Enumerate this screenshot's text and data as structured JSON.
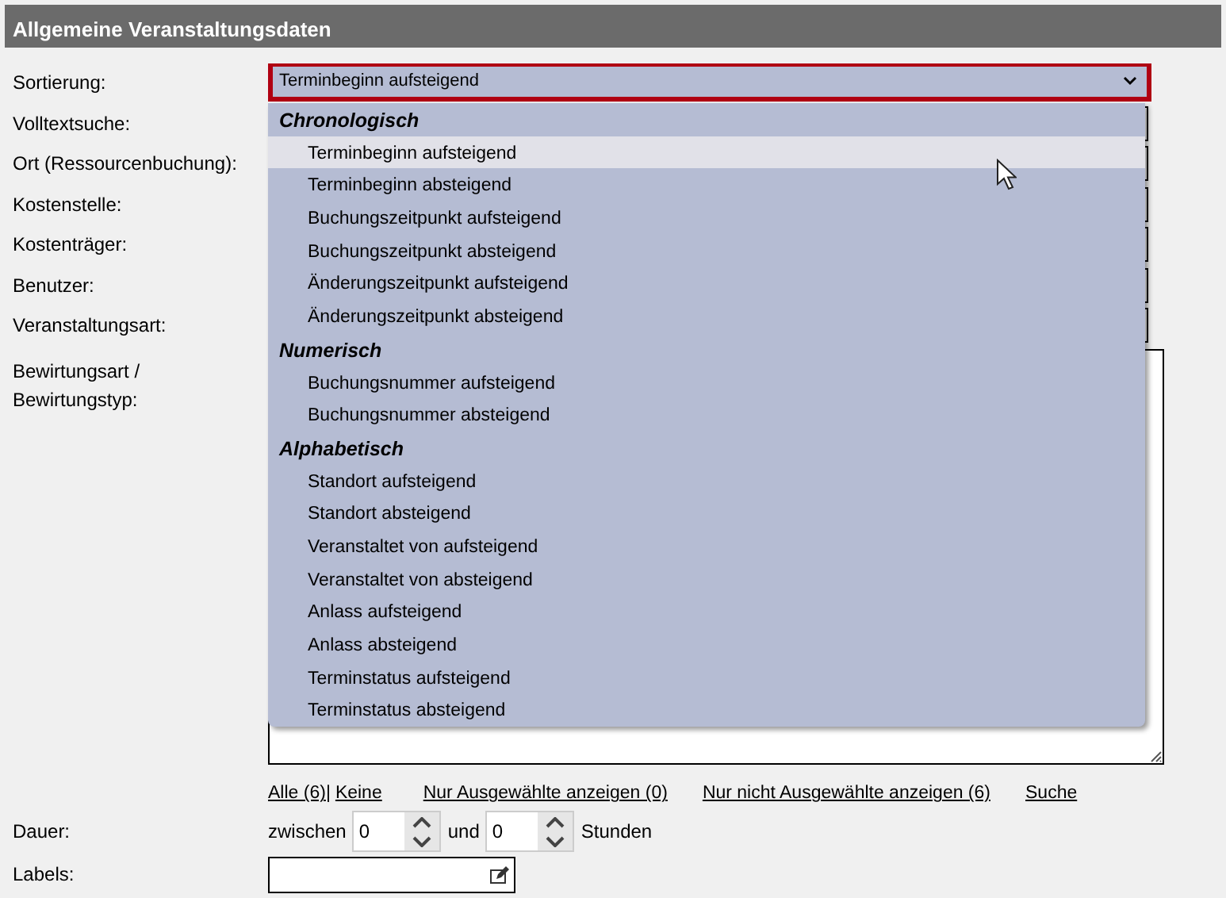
{
  "section": {
    "title": "Allgemeine Veranstaltungsdaten"
  },
  "sort": {
    "label": "Sortierung:",
    "value": "Terminbeginn aufsteigend",
    "expanded": true,
    "groups": [
      {
        "label": "Chronologisch",
        "options": [
          {
            "label": "Terminbeginn aufsteigend",
            "selected": true
          },
          {
            "label": "Terminbeginn absteigend",
            "selected": false
          },
          {
            "label": "Buchungszeitpunkt aufsteigend",
            "selected": false
          },
          {
            "label": "Buchungszeitpunkt absteigend",
            "selected": false
          },
          {
            "label": "Änderungszeitpunkt aufsteigend",
            "selected": false
          },
          {
            "label": "Änderungszeitpunkt absteigend",
            "selected": false
          }
        ]
      },
      {
        "label": "Numerisch",
        "options": [
          {
            "label": "Buchungsnummer aufsteigend",
            "selected": false
          },
          {
            "label": "Buchungsnummer absteigend",
            "selected": false
          }
        ]
      },
      {
        "label": "Alphabetisch",
        "options": [
          {
            "label": "Standort aufsteigend",
            "selected": false
          },
          {
            "label": "Standort absteigend",
            "selected": false
          },
          {
            "label": "Veranstaltet von aufsteigend",
            "selected": false
          },
          {
            "label": "Veranstaltet von absteigend",
            "selected": false
          },
          {
            "label": "Anlass aufsteigend",
            "selected": false
          },
          {
            "label": "Anlass absteigend",
            "selected": false
          },
          {
            "label": "Terminstatus aufsteigend",
            "selected": false
          },
          {
            "label": "Terminstatus absteigend",
            "selected": false
          }
        ]
      }
    ]
  },
  "fields": [
    {
      "label": "Volltextsuche:"
    },
    {
      "label": "Ort (Ressourcenbuchung):"
    },
    {
      "label": "Kostenstelle:"
    },
    {
      "label": "Kostenträger:"
    },
    {
      "label": "Benutzer:"
    },
    {
      "label": "Veranstaltungsart:"
    }
  ],
  "catering": {
    "label": "Bewirtungsart / Bewirtungstyp:"
  },
  "links": [
    {
      "label": "Alle (6)"
    },
    {
      "label": "|",
      "kind": "separator"
    },
    {
      "label": "Keine"
    },
    {
      "label": "Nur Ausgewählte anzeigen (0)"
    },
    {
      "label": "Nur nicht Ausgewählte anzeigen (6)"
    },
    {
      "label": "Suche"
    }
  ],
  "duration": {
    "label": "Dauer:",
    "prefix": "zwischen",
    "from": "0",
    "middle": "und",
    "to": "0",
    "unit": "Stunden"
  },
  "labels": {
    "label": "Labels:"
  }
}
